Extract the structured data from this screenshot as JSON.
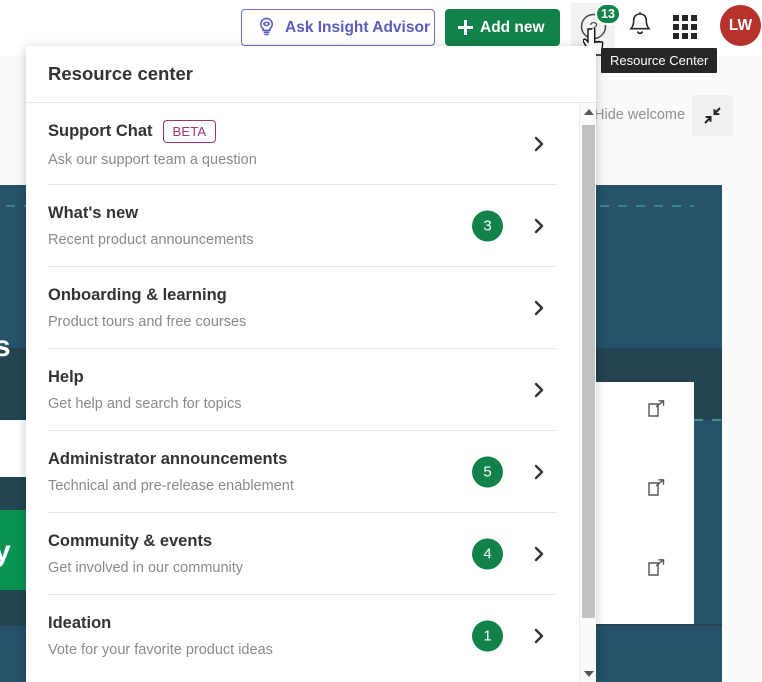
{
  "toolbar": {
    "ask_advisor": {
      "label": "Ask Insight Advisor",
      "icon": "insight-advisor-icon",
      "accent": "#5b5bbd"
    },
    "add_new": {
      "label": "Add new",
      "icon": "plus-icon",
      "accent": "#12824a"
    },
    "help": {
      "icon": "question-mark-circle-icon",
      "badge_count": "13",
      "badge_color": "#12824a"
    },
    "notifications": {
      "icon": "bell-icon"
    },
    "app_switcher": {
      "icon": "grid-apps-icon"
    },
    "avatar": {
      "initials": "LW",
      "color": "#b5332c"
    },
    "tooltip": {
      "text": "Resource Center"
    }
  },
  "background": {
    "hide_welcome_label": "Hide welcome",
    "collapse_icon": "collapse-arrows-icon",
    "external_link_icon": "external-link-icon",
    "text_fragment_left": "s",
    "text_fragment_green": "y",
    "colors": {
      "hero": "#26526b",
      "hero_dark": "#234450",
      "green": "#0a9250",
      "teal_dash": "#3f8f8a"
    }
  },
  "popover": {
    "title": "Resource center",
    "chevron_icon": "chevron-right-icon",
    "scrollbar": {
      "up_icon": "scroll-up-arrow-icon",
      "down_icon": "scroll-down-arrow-icon"
    },
    "items": [
      {
        "title": "Support Chat",
        "subtitle": "Ask our support team a question",
        "badge_text": "BETA",
        "count": null
      },
      {
        "title": "What's new",
        "subtitle": "Recent product announcements",
        "badge_text": null,
        "count": "3"
      },
      {
        "title": "Onboarding & learning",
        "subtitle": "Product tours and free courses",
        "badge_text": null,
        "count": null
      },
      {
        "title": "Help",
        "subtitle": "Get help and search for topics",
        "badge_text": null,
        "count": null
      },
      {
        "title": "Administrator announcements",
        "subtitle": "Technical and pre-release enablement",
        "badge_text": null,
        "count": "5"
      },
      {
        "title": "Community & events",
        "subtitle": "Get involved in our community",
        "badge_text": null,
        "count": "4"
      },
      {
        "title": "Ideation",
        "subtitle": "Vote for your favorite product ideas",
        "badge_text": null,
        "count": "1"
      }
    ]
  }
}
